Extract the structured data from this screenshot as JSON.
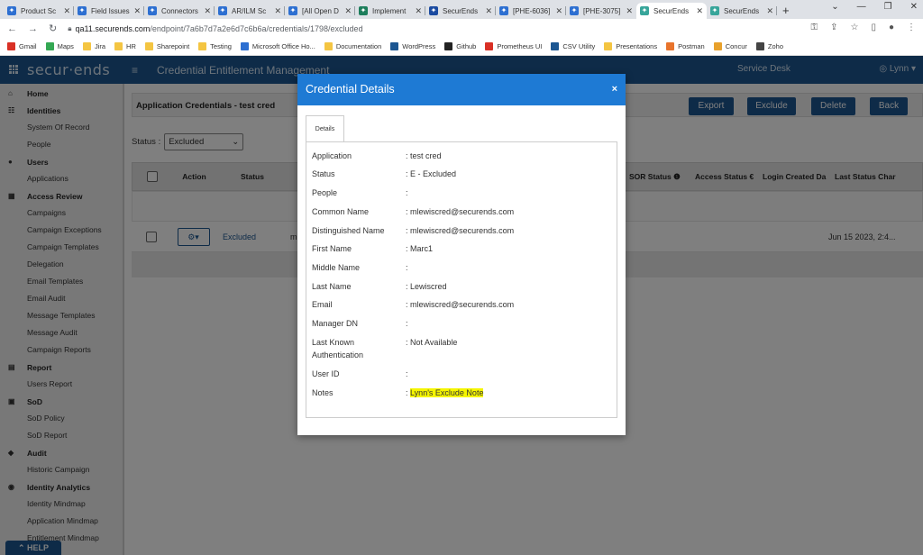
{
  "browser": {
    "tabs": [
      {
        "label": "Product Sc",
        "color": "#2d6fd1"
      },
      {
        "label": "Field Issues",
        "color": "#2d6fd1"
      },
      {
        "label": "Connectors",
        "color": "#2d6fd1"
      },
      {
        "label": "AR/ILM Sc",
        "color": "#2d6fd1"
      },
      {
        "label": "[All Open D",
        "color": "#2d6fd1"
      },
      {
        "label": "Implement",
        "color": "#1c7d5b"
      },
      {
        "label": "SecurEnds",
        "color": "#1a4aa0"
      },
      {
        "label": "[PHE-6036]",
        "color": "#2d6fd1"
      },
      {
        "label": "[PHE-3075]",
        "color": "#2d6fd1"
      },
      {
        "label": "SecurEnds",
        "color": "#37a59a"
      },
      {
        "label": "SecurEnds",
        "color": "#37a59a"
      }
    ],
    "url_host": "qa11.securends.com",
    "url_path": "/endpoint/7a6b7d7a2e6d7c6b6a/credentials/1798/excluded",
    "bookmarks": [
      {
        "label": "Gmail",
        "color": "#d93025"
      },
      {
        "label": "Maps",
        "color": "#34a853"
      },
      {
        "label": "Jira",
        "color": "#f4c542"
      },
      {
        "label": "HR",
        "color": "#f4c542"
      },
      {
        "label": "Sharepoint",
        "color": "#f4c542"
      },
      {
        "label": "Testing",
        "color": "#f4c542"
      },
      {
        "label": "Microsoft Office Ho...",
        "color": "#2d6fd1"
      },
      {
        "label": "Documentation",
        "color": "#f4c542"
      },
      {
        "label": "WordPress",
        "color": "#1c5691"
      },
      {
        "label": "Github",
        "color": "#222"
      },
      {
        "label": "Prometheus UI",
        "color": "#d93025"
      },
      {
        "label": "CSV Utility",
        "color": "#1c5691"
      },
      {
        "label": "Presentations",
        "color": "#f4c542"
      },
      {
        "label": "Postman",
        "color": "#e8742c"
      },
      {
        "label": "Concur",
        "color": "#e8a12c"
      },
      {
        "label": "Zoho",
        "color": "#444"
      }
    ]
  },
  "app": {
    "logo": "secur·ends",
    "title": "Credential Entitlement Management",
    "service_desk": "Service Desk",
    "user": "Lynn"
  },
  "sidebar": {
    "sections": [
      {
        "icon": "⌂",
        "label": "Home",
        "items": []
      },
      {
        "icon": "☷",
        "label": "Identities",
        "items": [
          "System Of Record",
          "People"
        ]
      },
      {
        "icon": "●",
        "label": "Users",
        "items": [
          "Applications"
        ]
      },
      {
        "icon": "▦",
        "label": "Access Review",
        "items": [
          "Campaigns",
          "Campaign Exceptions",
          "Campaign Templates",
          "Delegation",
          "Email Templates",
          "Email Audit",
          "Message Templates",
          "Message Audit",
          "Campaign Reports"
        ]
      },
      {
        "icon": "▤",
        "label": "Report",
        "items": [
          "Users Report"
        ]
      },
      {
        "icon": "▣",
        "label": "SoD",
        "items": [
          "SoD Policy",
          "SoD Report"
        ]
      },
      {
        "icon": "◆",
        "label": "Audit",
        "items": [
          "Historic Campaign"
        ]
      },
      {
        "icon": "◉",
        "label": "Identity Analytics",
        "items": [
          "Identity Mindmap",
          "Application Mindmap",
          "Entitlement Mindmap"
        ]
      }
    ],
    "help": "HELP"
  },
  "main": {
    "panel_title": "Application Credentials - test cred",
    "buttons": {
      "export": "Export",
      "exclude": "Exclude",
      "delete": "Delete",
      "back": "Back"
    },
    "status_label": "Status :",
    "status_value": "Excluded",
    "columns": [
      "Action",
      "Status",
      "SOR Status",
      "Access Status",
      "Login Created Da",
      "Last Status Char"
    ],
    "row": {
      "status": "Excluded",
      "name": "mle",
      "last_status": "Jun 15 2023, 2:4..."
    }
  },
  "modal": {
    "title": "Credential Details",
    "close": "×",
    "tab": "Details",
    "fields": [
      {
        "label": "Application",
        "value": ": test cred"
      },
      {
        "label": "Status",
        "value": ": E - Excluded"
      },
      {
        "label": "People",
        "value": ":"
      },
      {
        "label": "Common Name",
        "value": ": mlewiscred@securends.com"
      },
      {
        "label": "Distinguished Name",
        "value": ": mlewiscred@securends.com"
      },
      {
        "label": "First Name",
        "value": ": Marc1"
      },
      {
        "label": "Middle Name",
        "value": ":"
      },
      {
        "label": "Last Name",
        "value": ": Lewiscred"
      },
      {
        "label": "Email",
        "value": ": mlewiscred@securends.com"
      },
      {
        "label": "Manager DN",
        "value": ":"
      },
      {
        "label": "Last Known Authentication",
        "value": ": Not Available"
      },
      {
        "label": "User ID",
        "value": ":"
      },
      {
        "label": "Notes",
        "value": "Lynn's Exclude Note"
      }
    ],
    "notes_highlight": "#f5f500"
  }
}
